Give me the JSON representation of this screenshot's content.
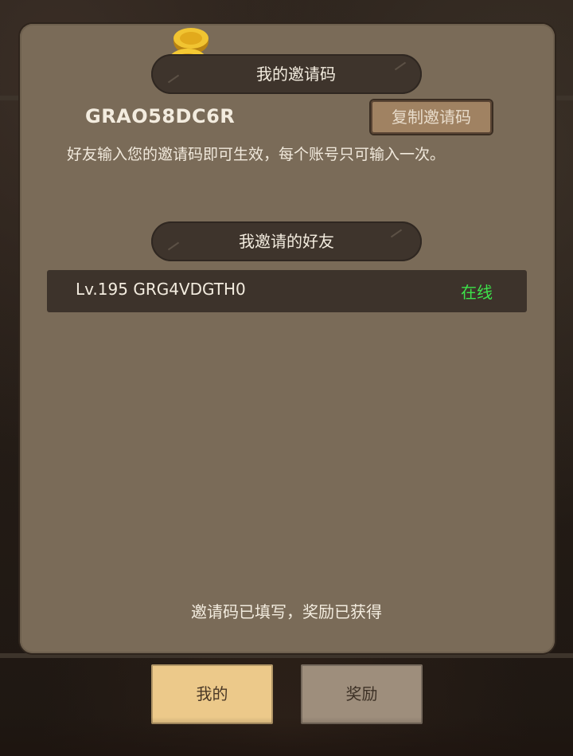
{
  "invite_banner": {
    "title": "我的邀请码"
  },
  "invite_code": "GRAO58DC6R",
  "copy_button_label": "复制邀请码",
  "description": "好友输入您的邀请码即可生效，每个账号只可输入一次。",
  "friends_banner": {
    "title": "我邀请的好友"
  },
  "friends": [
    {
      "info": "Lv.195 GRG4VDGTH0",
      "status": "在线"
    }
  ],
  "footer_note": "邀请码已填写，奖励已获得",
  "tabs": [
    {
      "label": "我的"
    },
    {
      "label": "奖励"
    }
  ],
  "colors": {
    "panel": "#7a6b58",
    "banner": "#3e342c",
    "online": "#3de24a",
    "tab_active": "#ecc98a",
    "tab_inactive": "#9e8e7c"
  },
  "icons": [
    "coins-icon"
  ]
}
